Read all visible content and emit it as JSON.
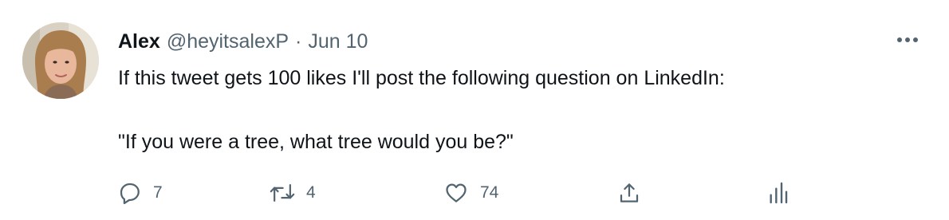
{
  "tweet": {
    "author_name": "Alex",
    "handle": "@heyitsalexP",
    "separator": "·",
    "date": "Jun 10",
    "text_line1": "If this tweet gets 100 likes I'll post the following question on LinkedIn:",
    "text_line2": "\"If you were a tree, what tree would you be?\""
  },
  "actions": {
    "reply_count": "7",
    "retweet_count": "4",
    "like_count": "74"
  },
  "icons": {
    "reply": "reply-icon",
    "retweet": "retweet-icon",
    "like": "heart-icon",
    "share": "share-icon",
    "analytics": "analytics-icon",
    "more": "more-icon"
  },
  "colors": {
    "text_primary": "#0f1419",
    "text_secondary": "#536471"
  }
}
